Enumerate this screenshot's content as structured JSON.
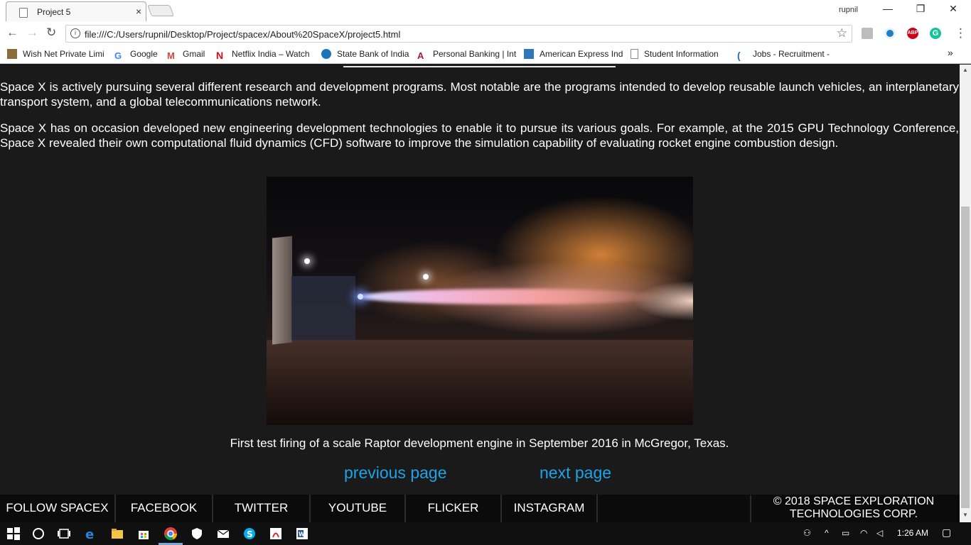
{
  "browser": {
    "tab_title": "Project 5",
    "tab_close": "×",
    "user_name": "rupnil",
    "window_controls": {
      "minimize": "—",
      "maximize": "❐",
      "close": "✕"
    },
    "url": "file:///C:/Users/rupnil/Desktop/Project/spacex/About%20SpaceX/project5.html",
    "nav": {
      "back": "←",
      "forward": "→",
      "reload": "↻"
    },
    "star": "☆",
    "overflow_more": "»",
    "menu": "⋮",
    "bookmarks": [
      {
        "label": "Wish Net Private Limi",
        "icon": "wishnet-icon",
        "color": "#8a6d3b"
      },
      {
        "label": "Google",
        "icon": "google-icon",
        "color": "#4285f4"
      },
      {
        "label": "Gmail",
        "icon": "gmail-icon",
        "color": "#d44638"
      },
      {
        "label": "Netflix India – Watch",
        "icon": "netflix-icon",
        "color": "#e50914"
      },
      {
        "label": "State Bank of India",
        "icon": "sbi-icon",
        "color": "#1b75bb"
      },
      {
        "label": "Personal Banking | Int",
        "icon": "bank-icon",
        "color": "#a61c2e"
      },
      {
        "label": "American Express Ind",
        "icon": "amex-icon",
        "color": "#2e77bb"
      },
      {
        "label": "Student Information",
        "icon": "document-icon",
        "color": "#888888"
      },
      {
        "label": "Jobs - Recruitment -",
        "icon": "jobs-icon",
        "color": "#2a6ab2"
      }
    ],
    "extensions": [
      {
        "name": "extension-gray-icon",
        "color": "#bdbdbd"
      },
      {
        "name": "extension-blue-icon",
        "color": "#1d7fc4"
      },
      {
        "name": "adblock-plus-icon",
        "color": "#d0021b",
        "text": "ABP"
      },
      {
        "name": "grammarly-icon",
        "color": "#15c39a",
        "text": "G"
      }
    ]
  },
  "content": {
    "paragraph1": "Space X is actively pursuing several different research and development programs. Most notable are the programs intended to develop reusable launch vehicles, an interplanetary transport system, and a global telecommunications network.",
    "paragraph2": "Space X has on occasion developed new engineering development technologies to enable it to pursue its various goals. For example, at the 2015 GPU Technology Conference, Space X revealed their own computational fluid dynamics (CFD) software to improve the simulation capability of evaluating rocket engine combustion design.",
    "caption": "First test firing of a scale Raptor development engine in September 2016 in McGregor, Texas.",
    "previous_page": "previous page",
    "next_page": "next page",
    "link_color": "#1fa3e6"
  },
  "footer": {
    "items": [
      "FOLLOW SPACEX",
      "FACEBOOK",
      "TWITTER",
      "YOUTUBE",
      "FLICKER",
      "INSTAGRAM"
    ],
    "copyright_line1": "© 2018 SPACE EXPLORATION",
    "copyright_line2": "TECHNOLOGIES CORP."
  },
  "taskbar": {
    "time": "1:26 AM",
    "apps": [
      "windows-start-icon",
      "cortana-icon",
      "task-view-icon",
      "edge-icon",
      "file-explorer-icon",
      "store-icon",
      "chrome-icon",
      "shield-icon",
      "mail-icon",
      "skype-icon",
      "acrobat-icon",
      "word-icon"
    ]
  }
}
